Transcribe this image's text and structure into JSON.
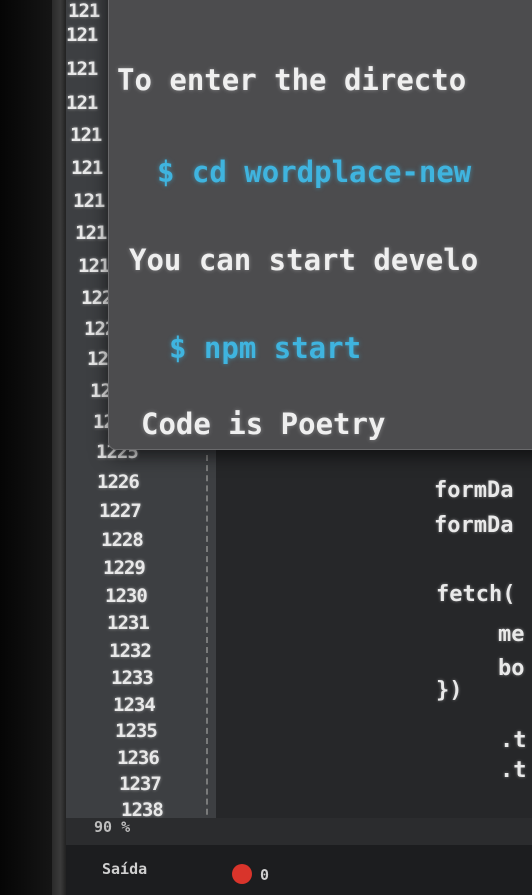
{
  "gutter": {
    "lines": [
      "121",
      "121",
      "121",
      "121",
      "121",
      "121",
      "121",
      "121",
      "121",
      "122",
      "122",
      "122",
      "122",
      "122",
      "1225",
      "1226",
      "1227",
      "1228",
      "1229",
      "1230",
      "1231",
      "1232",
      "1233",
      "1234",
      "1235",
      "1236",
      "1237",
      "1238"
    ]
  },
  "tooltip": {
    "line1": "To enter the directo",
    "cmd1": "$ cd wordplace-new",
    "line2": "You can start develo",
    "cmd2": "$ npm start",
    "line3": "Code is Poetry"
  },
  "code": {
    "lines": [
      "formDa",
      "formDa",
      "fetch(",
      "me",
      "bo",
      "})",
      ".t",
      ".t"
    ]
  },
  "statusbar": {
    "zoom": "90 %",
    "output_tab": "Saída",
    "error_count": "0"
  },
  "colors": {
    "command": "#3fb4df",
    "error": "#d9342b"
  }
}
